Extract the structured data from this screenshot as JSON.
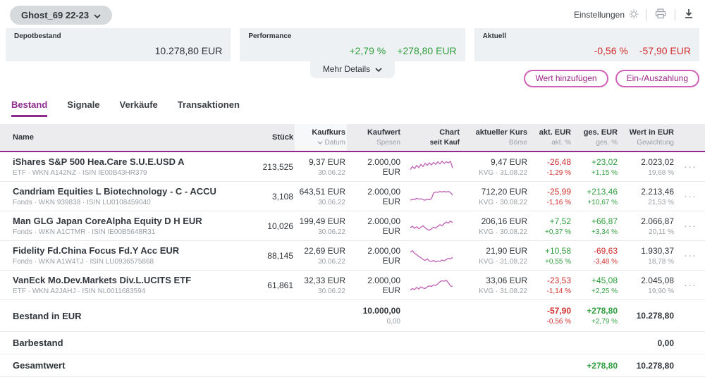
{
  "colors": {
    "accent_magenta": "#9c2287",
    "accent_purple": "#8f2b8f",
    "positive": "#2f9e3e",
    "negative": "#d22d2d",
    "spark": "#c05fb6",
    "card_bg": "#eef1f4",
    "header_bg": "#ececee"
  },
  "icons": {
    "dropdown": "chevron-down",
    "settings": "gear",
    "print": "printer",
    "export": "download-arrow",
    "sort": "chevron-down",
    "row_menu": "ellipsis"
  },
  "header": {
    "portfolio_name": "Ghost_69 22-23",
    "settings_label": "Einstellungen",
    "more_details_label": "Mehr Details",
    "cards": {
      "depot": {
        "label": "Depotbestand",
        "value": "10.278,80 EUR"
      },
      "performance": {
        "label": "Performance",
        "percent": "+2,79 %",
        "value": "+278,80 EUR"
      },
      "aktuell": {
        "label": "Aktuell",
        "percent": "-0,56 %",
        "value": "-57,90 EUR"
      }
    }
  },
  "actions": {
    "add_value_label": "Wert hinzufügen",
    "payment_label": "Ein-/Auszahlung"
  },
  "tabs": [
    {
      "label": "Bestand",
      "active": true
    },
    {
      "label": "Signale",
      "active": false
    },
    {
      "label": "Verkäufe",
      "active": false
    },
    {
      "label": "Transaktionen",
      "active": false
    }
  ],
  "table": {
    "columns": [
      {
        "line1": "Name",
        "line2": ""
      },
      {
        "line1": "Stück",
        "line2": ""
      },
      {
        "line1": "Kaufkurs",
        "line2": "Datum"
      },
      {
        "line1": "Kaufwert",
        "line2": "Spesen"
      },
      {
        "line1": "Chart",
        "line2": "seit Kauf"
      },
      {
        "line1": "aktueller Kurs",
        "line2": "Börse"
      },
      {
        "line1": "akt. EUR",
        "line2": "akt. %"
      },
      {
        "line1": "ges. EUR",
        "line2": "ges. %"
      },
      {
        "line1": "Wert in EUR",
        "line2": "Gewichtung"
      }
    ],
    "rows": [
      {
        "name": "iShares S&P 500 Hea.Care S.U.E.USD A",
        "meta": "ETF · WKN A142NZ · ISIN IE00B43HR379",
        "stueck": "213,525",
        "kaufkurs": "9,37 EUR",
        "kaufdatum": "30.06.22",
        "kaufwert": "2.000,00 EUR",
        "kurs": "9,47 EUR",
        "boerse": "KVG · 31.08.22",
        "akt_eur": "-26,48",
        "akt_pct": "-1,29 %",
        "ges_eur": "+23,02",
        "ges_pct": "+1,15 %",
        "wert": "2.023,02",
        "gewichtung": "19,68 %",
        "spark": [
          10,
          16,
          12,
          18,
          14,
          20,
          16,
          22,
          18,
          23,
          19,
          24,
          20,
          25,
          21,
          26,
          22,
          25,
          23,
          26,
          13
        ]
      },
      {
        "name": "Candriam Equities L Biotechnology - C - ACCU",
        "meta": "Fonds · WKN 939838 · ISIN LU0108459040",
        "stueck": "3,108",
        "kaufkurs": "643,51 EUR",
        "kaufdatum": "30.06.22",
        "kaufwert": "2.000,00 EUR",
        "kurs": "712,20 EUR",
        "boerse": "KVG · 30.08.22",
        "akt_eur": "-25,99",
        "akt_pct": "-1,16 %",
        "ges_eur": "+213,46",
        "ges_pct": "+10,67 %",
        "wert": "2.213,46",
        "gewichtung": "21,53 %",
        "spark": [
          8,
          10,
          9,
          12,
          10,
          11,
          9,
          8,
          10,
          9,
          11,
          22,
          24,
          23,
          25,
          24,
          25,
          24,
          25,
          23,
          18
        ]
      },
      {
        "name": "Man GLG Japan CoreAlpha Equity D H EUR",
        "meta": "Fonds · WKN A1CTMR · ISIN IE00B5648R31",
        "stueck": "10,026",
        "kaufkurs": "199,49 EUR",
        "kaufdatum": "30.06.22",
        "kaufwert": "2.000,00 EUR",
        "kurs": "206,16 EUR",
        "boerse": "KVG · 30.08.22",
        "akt_eur": "+7,52",
        "akt_pct": "+0,37 %",
        "ges_eur": "+66,87",
        "ges_pct": "+3,34 %",
        "wert": "2.066,87",
        "gewichtung": "20,11 %",
        "spark": [
          12,
          15,
          11,
          14,
          10,
          13,
          16,
          12,
          9,
          7,
          10,
          13,
          11,
          15,
          18,
          16,
          20,
          23,
          21,
          25,
          22
        ]
      },
      {
        "name": "Fidelity Fd.China Focus Fd.Y Acc EUR",
        "meta": "Fonds · WKN A1W4TJ · ISIN LU0936575868",
        "stueck": "88,145",
        "kaufkurs": "22,69 EUR",
        "kaufdatum": "30.06.22",
        "kaufwert": "2.000,00 EUR",
        "kurs": "21,90 EUR",
        "boerse": "KVG · 31.08.22",
        "akt_eur": "+10,58",
        "akt_pct": "+0,55 %",
        "ges_eur": "-69,63",
        "ges_pct": "-3,48 %",
        "wert": "1.930,37",
        "gewichtung": "18,78 %",
        "spark": [
          22,
          25,
          20,
          17,
          14,
          11,
          8,
          6,
          9,
          5,
          4,
          6,
          3,
          5,
          4,
          7,
          5,
          8,
          10,
          9,
          12
        ]
      },
      {
        "name": "VanEck Mo.Dev.Markets Div.L.UCITS ETF",
        "meta": "ETF · WKN A2JAHJ · ISIN NL0011683594",
        "stueck": "61,861",
        "kaufkurs": "32,33 EUR",
        "kaufdatum": "30.06.22",
        "kaufwert": "2.000,00 EUR",
        "kurs": "33,06 EUR",
        "boerse": "KVG · 31.08.22",
        "akt_eur": "-23,53",
        "akt_pct": "-1,14 %",
        "ges_eur": "+45,08",
        "ges_pct": "+2,25 %",
        "wert": "2.045,08",
        "gewichtung": "19,90 %",
        "spark": [
          6,
          9,
          7,
          11,
          8,
          12,
          10,
          9,
          12,
          14,
          13,
          16,
          15,
          18,
          22,
          24,
          23,
          25,
          20,
          14,
          13
        ]
      }
    ]
  },
  "summary": {
    "bestand": {
      "label": "Bestand in EUR",
      "kaufwert": "10.000,00",
      "spesen": "0,00",
      "akt_eur": "-57,90",
      "akt_pct": "-0,56 %",
      "ges_eur": "+278,80",
      "ges_pct": "+2,79 %",
      "wert": "10.278,80"
    },
    "barbestand": {
      "label": "Barbestand",
      "wert": "0,00"
    },
    "gesamtwert": {
      "label": "Gesamtwert",
      "ges_eur": "+278,80",
      "wert": "10.278,80"
    }
  }
}
